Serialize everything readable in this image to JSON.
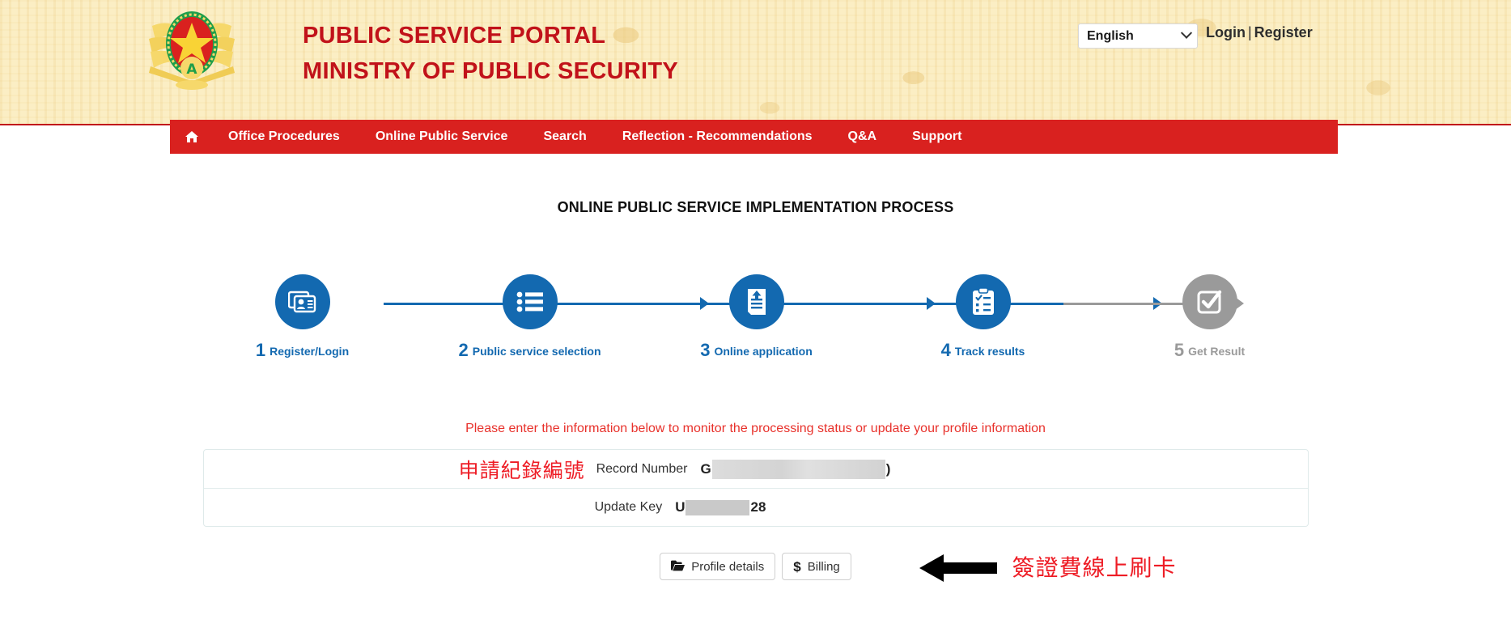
{
  "header": {
    "emblem_name": "vietnam-public-security-emblem",
    "brand_line1": "PUBLIC SERVICE PORTAL",
    "brand_line2": "MINISTRY OF PUBLIC SECURITY",
    "language": "English",
    "login_label": "Login",
    "auth_separator": "|",
    "register_label": "Register",
    "brand_color": "#c1121a",
    "background_color": "#fbeec4"
  },
  "nav": {
    "home_icon": "home-icon",
    "bar_color": "#d9211f",
    "items": [
      {
        "label": "Office Procedures"
      },
      {
        "label": "Online Public Service"
      },
      {
        "label": "Search"
      },
      {
        "label": "Reflection - Recommendations"
      },
      {
        "label": "Q&A"
      },
      {
        "label": "Support"
      }
    ]
  },
  "main": {
    "page_title": "ONLINE PUBLIC SERVICE IMPLEMENTATION PROCESS",
    "notice": "Please enter the information below to monitor the processing status or update your profile information",
    "active_color": "#1369b0",
    "done_color": "#9a9a9a"
  },
  "steps": [
    {
      "num": "1",
      "label": "Register/Login",
      "icon": "id-card-icon",
      "state": "active"
    },
    {
      "num": "2",
      "label": "Public service selection",
      "icon": "list-icon",
      "state": "active"
    },
    {
      "num": "3",
      "label": "Online application",
      "icon": "upload-document-icon",
      "state": "active"
    },
    {
      "num": "4",
      "label": "Track results",
      "icon": "clipboard-check-icon",
      "state": "active"
    },
    {
      "num": "5",
      "label": "Get Result",
      "icon": "check-square-icon",
      "state": "done"
    }
  ],
  "record": {
    "rows": [
      {
        "annotation": "申請紀錄編號",
        "label": "Record Number",
        "value_prefix": "G",
        "value_suffix": ")",
        "redacted": true
      },
      {
        "annotation": "",
        "label": "Update Key",
        "value_prefix": "U",
        "value_suffix": "28",
        "redacted": true
      }
    ]
  },
  "actions": {
    "profile_icon": "folder-open-icon",
    "profile_label": "Profile details",
    "billing_icon": "dollar-icon",
    "billing_label": "Billing",
    "arrow_icon": "left-arrow-annotation",
    "annotation": "簽證費線上刷卡",
    "annotation_color": "#ee1c25"
  }
}
